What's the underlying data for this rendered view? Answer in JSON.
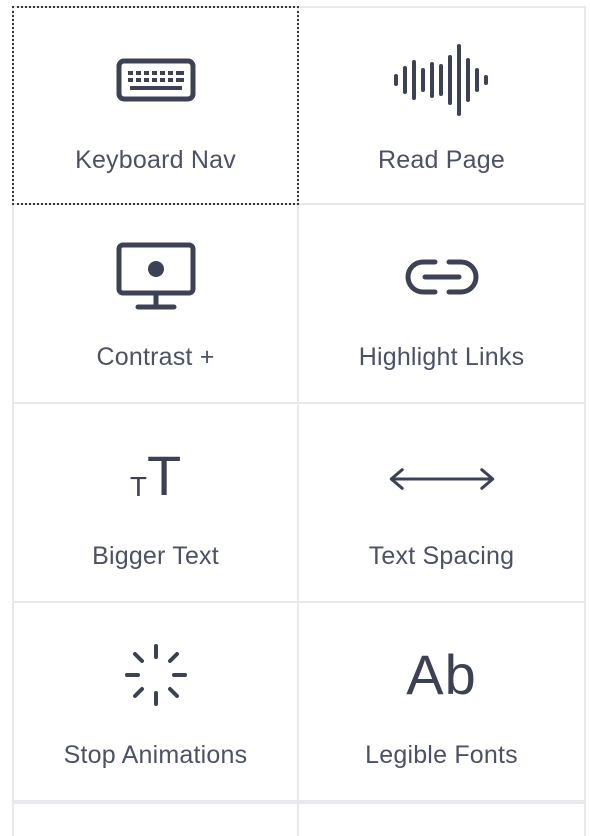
{
  "tiles": [
    {
      "label": "Keyboard Nav",
      "icon": "keyboard-icon",
      "focused": true
    },
    {
      "label": "Read Page",
      "icon": "soundwave-icon"
    },
    {
      "label": "Contrast +",
      "icon": "monitor-icon"
    },
    {
      "label": "Highlight Links",
      "icon": "link-icon"
    },
    {
      "label": "Bigger Text",
      "icon": "text-size-icon",
      "icon_text_small": "T",
      "icon_text_big": "T"
    },
    {
      "label": "Text Spacing",
      "icon": "double-arrow-icon"
    },
    {
      "label": "Stop Animations",
      "icon": "loading-spinner-icon"
    },
    {
      "label": "Legible Fonts",
      "icon": "font-ab-icon",
      "icon_text": "Ab"
    }
  ],
  "colors": {
    "text": "#4c5166",
    "icon": "#3c4156",
    "border": "#e9e9ed",
    "focus_outline": "#3a3a3a",
    "background": "#ffffff"
  }
}
